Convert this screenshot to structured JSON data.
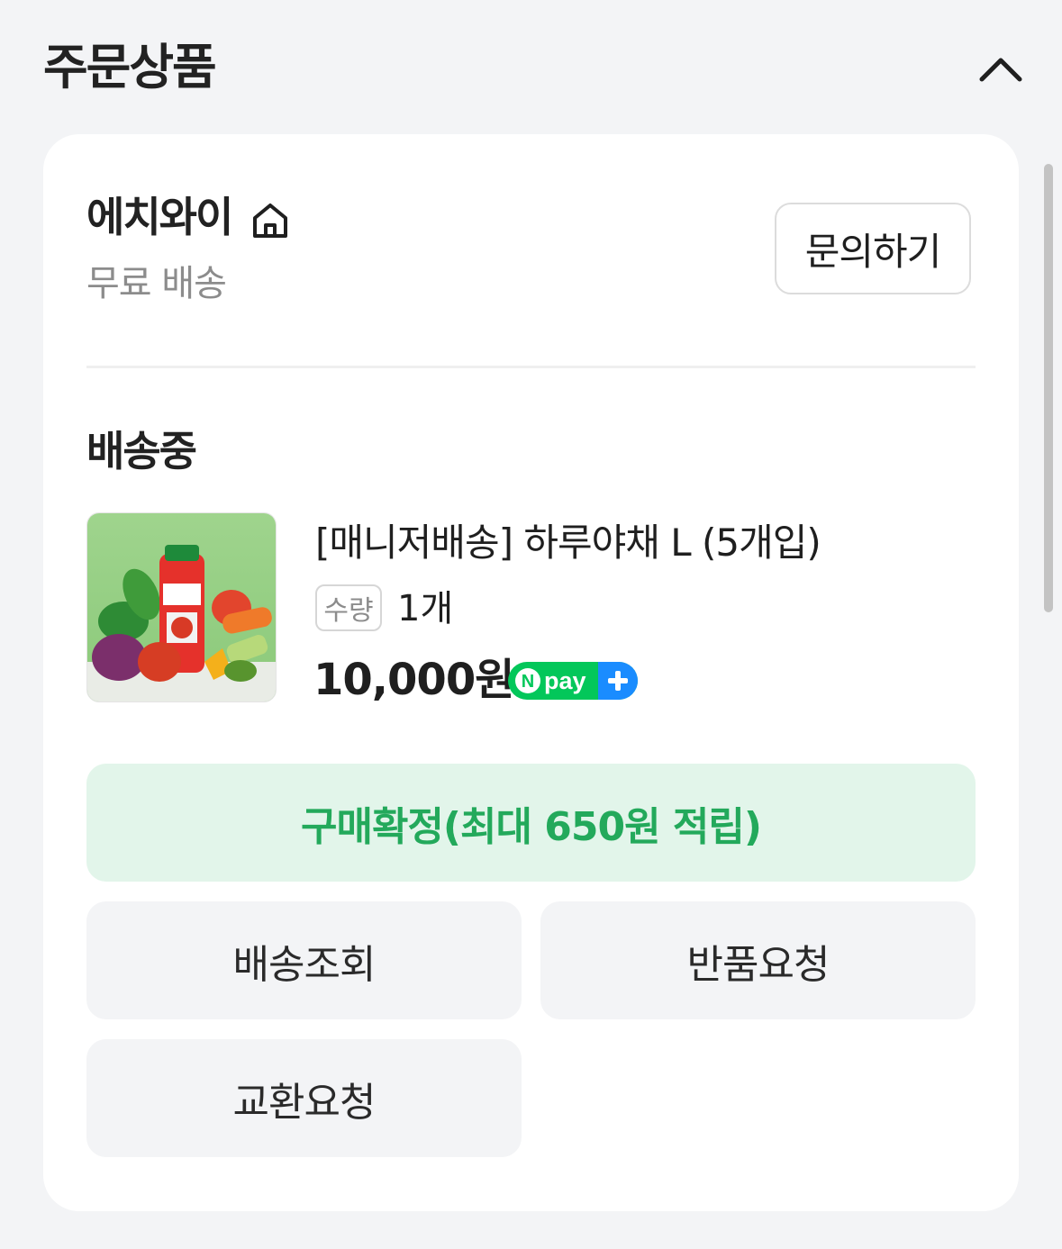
{
  "section": {
    "title": "주문상품"
  },
  "seller": {
    "name": "에치와이",
    "shipping": "무료 배송",
    "inquiry_label": "문의하기"
  },
  "order": {
    "status": "배송중",
    "product": {
      "name": "[매니저배송] 하루야채 L (5개입)",
      "qty_label": "수량",
      "qty_value": "1개",
      "price": "10,000원",
      "pay_badge": "Npay+"
    }
  },
  "actions": {
    "confirm_label": "구매확정(최대 650원 적립)",
    "track_label": "배송조회",
    "return_label": "반품요청",
    "exchange_label": "교환요청"
  },
  "colors": {
    "accent_green": "#23a95b",
    "npay_green": "#03c75a",
    "npay_blue": "#1a8cff"
  }
}
